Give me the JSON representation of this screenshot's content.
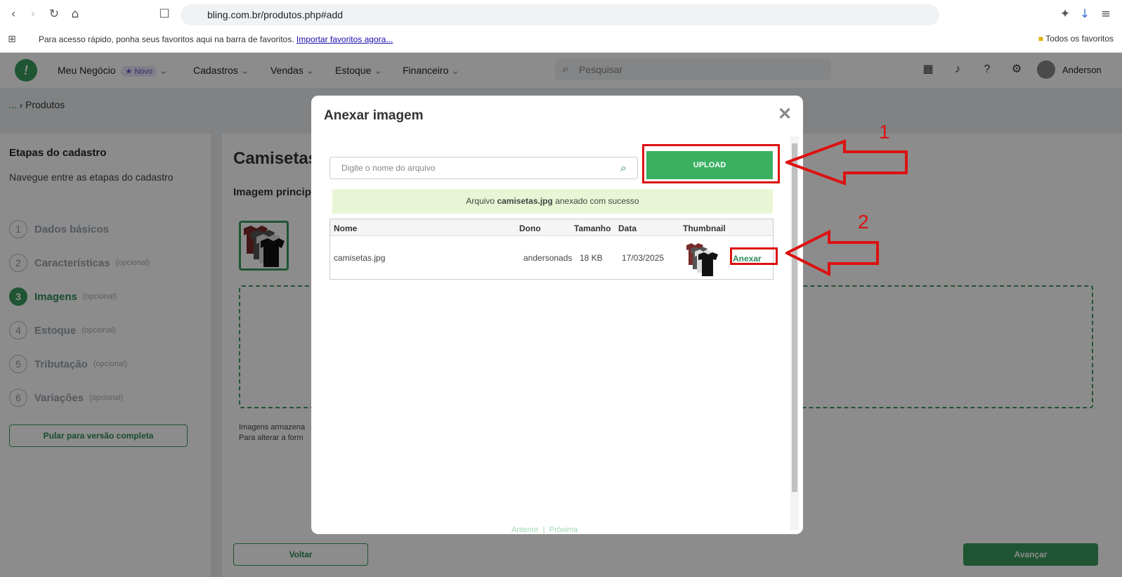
{
  "browser": {
    "url": "bling.com.br/produtos.php#add",
    "bookmarks_prompt": "Para acesso rápido, ponha seus favoritos aqui na barra de favoritos.",
    "bookmarks_link": "Importar favoritos agora...",
    "all_bookmarks": "Todos os favoritos"
  },
  "app_nav": {
    "business": "Meu Negócio",
    "new_badge": "Novo",
    "menu": [
      "Cadastros",
      "Vendas",
      "Estoque",
      "Financeiro"
    ],
    "search_placeholder": "Pesquisar",
    "user": "Anderson"
  },
  "breadcrumb": {
    "prefix": "...",
    "current": "Produtos"
  },
  "sidebar": {
    "title": "Etapas do cadastro",
    "subtitle": "Navegue entre as etapas do cadastro",
    "steps": [
      {
        "num": "1",
        "label": "Dados básicos",
        "optional": ""
      },
      {
        "num": "2",
        "label": "Características",
        "optional": "(opcional)"
      },
      {
        "num": "3",
        "label": "Imagens",
        "optional": "(opcional)"
      },
      {
        "num": "4",
        "label": "Estoque",
        "optional": "(opcional)"
      },
      {
        "num": "5",
        "label": "Tributação",
        "optional": "(opcional)"
      },
      {
        "num": "6",
        "label": "Variações",
        "optional": "(opcional)"
      }
    ],
    "skip_label": "Pular para versão completa"
  },
  "main": {
    "title": "Camisetas",
    "section": "Imagem princip",
    "note_line1": "Imagens armazena",
    "note_line2": "Para alterar a form",
    "back_label": "Voltar",
    "next_label": "Avançar"
  },
  "modal": {
    "title": "Anexar imagem",
    "search_placeholder": "Digite o nome do arquivo",
    "upload_label": "UPLOAD",
    "success_prefix": "Arquivo",
    "success_file": "camisetas.jpg",
    "success_suffix": "anexado com sucesso",
    "columns": [
      "Nome",
      "Dono",
      "Tamanho",
      "Data",
      "Thumbnail"
    ],
    "rows": [
      {
        "name": "camisetas.jpg",
        "owner": "andersonads",
        "size": "18 KB",
        "date": "17/03/2025",
        "action": "Anexar"
      }
    ],
    "pager_prev": "Anterior",
    "pager_sep": "|",
    "pager_next": "Próxima"
  },
  "annotations": {
    "label_1": "1",
    "label_2": "2",
    "color": "#dd1111"
  }
}
